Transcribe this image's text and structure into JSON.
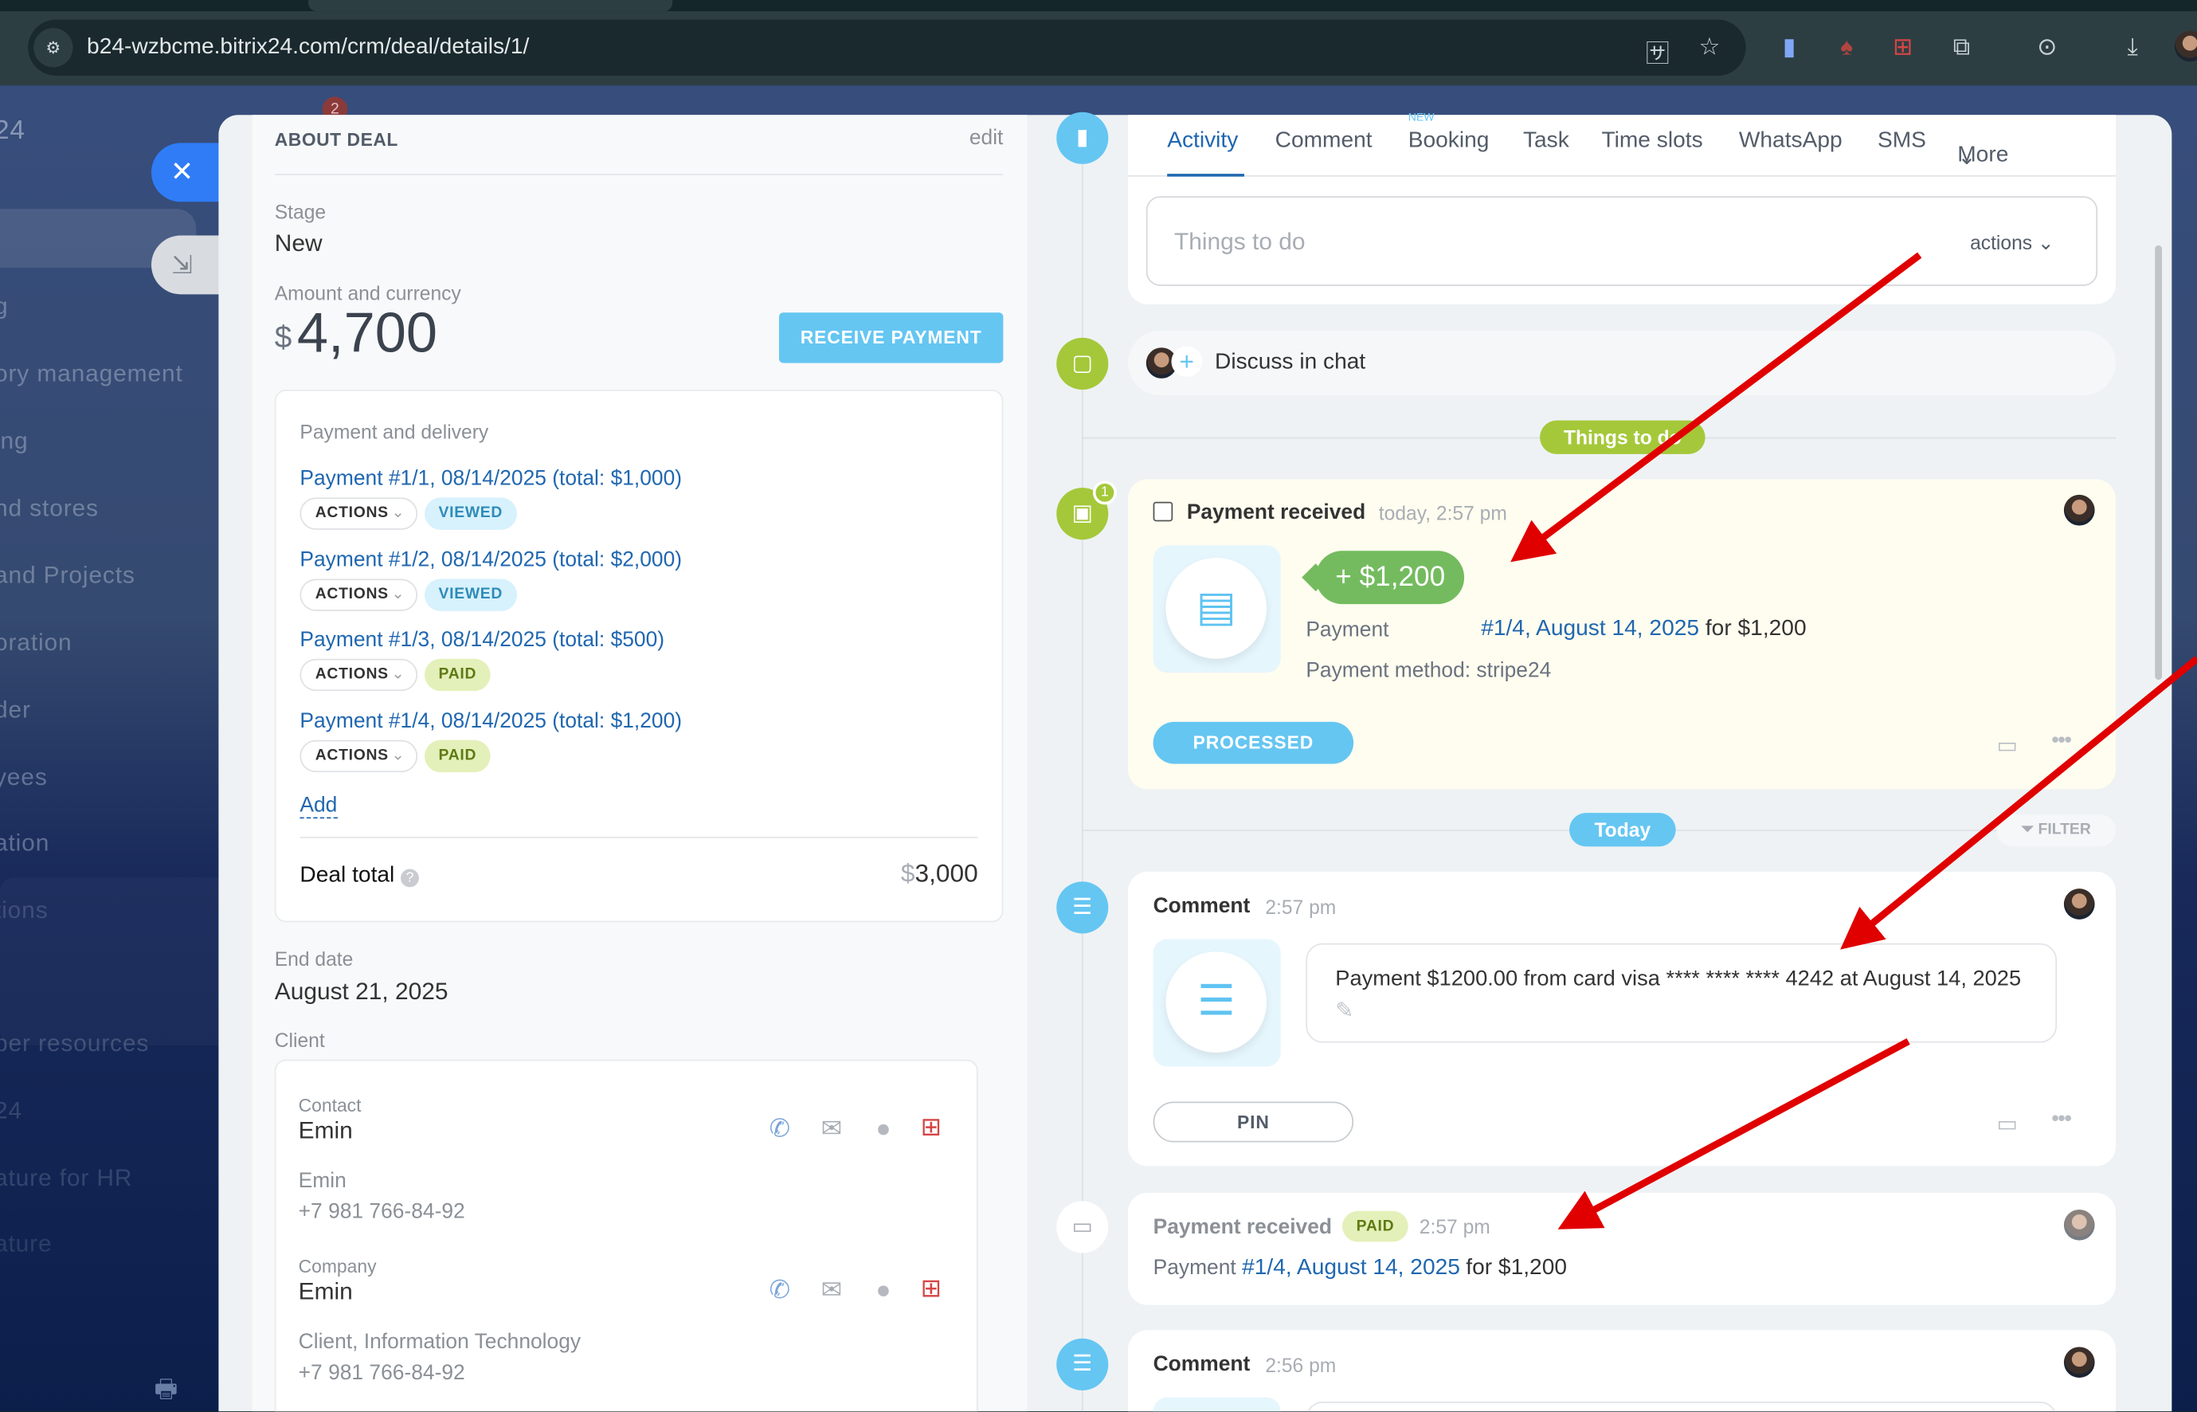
{
  "browser": {
    "url": "b24-wzbcme.bitrix24.com/crm/deal/details/1/",
    "icons": [
      "site-settings-icon",
      "translate-icon",
      "star-icon",
      "extension-blue-icon",
      "extension-red-icon",
      "extension-chat-icon",
      "puzzle-icon",
      "screenshot-icon",
      "download-icon",
      "profile-avatar"
    ]
  },
  "sidebar": {
    "logo": "24",
    "notification_count": "2",
    "items": [
      "g",
      "ory management",
      "ing",
      "nd stores",
      "and Projects",
      "oration",
      "der",
      "yees",
      "ation",
      "tions",
      "per resources",
      "24",
      "ature for HR",
      "ature"
    ]
  },
  "slider": {
    "close_icon": "✕",
    "minimize_icon": "⇲"
  },
  "about": {
    "heading": "ABOUT DEAL",
    "edit": "edit",
    "stage_label": "Stage",
    "stage_value": "New",
    "amount_label": "Amount and currency",
    "currency_symbol": "$",
    "amount": "4,700",
    "receive_payment": "RECEIVE PAYMENT",
    "payment_section": "Payment and delivery",
    "payments": [
      {
        "title": "Payment #1/1, 08/14/2025 (total: $1,000)",
        "actions": "ACTIONS",
        "status": "VIEWED"
      },
      {
        "title": "Payment #1/2, 08/14/2025 (total: $2,000)",
        "actions": "ACTIONS",
        "status": "VIEWED"
      },
      {
        "title": "Payment #1/3, 08/14/2025 (total: $500)",
        "actions": "ACTIONS",
        "status": "PAID"
      },
      {
        "title": "Payment #1/4, 08/14/2025 (total: $1,200)",
        "actions": "ACTIONS",
        "status": "PAID"
      }
    ],
    "add": "Add",
    "deal_total_label": "Deal total",
    "deal_total_currency": "$",
    "deal_total": "3,000",
    "end_date_label": "End date",
    "end_date": "August 21, 2025",
    "client_label": "Client",
    "contact_label": "Contact",
    "contact_name": "Emin",
    "contact_sub": "Emin",
    "contact_phone": "+7 981 766-84-92",
    "company_label": "Company",
    "company_name": "Emin",
    "company_sub": "Client, Information Technology",
    "company_phone": "+7 981 766-84-92"
  },
  "timeline": {
    "tabs": [
      "Activity",
      "Comment",
      "Booking",
      "Task",
      "Time slots",
      "WhatsApp",
      "SMS",
      "More"
    ],
    "new_badge": "NEW",
    "todo_placeholder": "Things to do",
    "actions": "actions",
    "discuss": "Discuss in chat",
    "things_to_do_divider": "Things to do",
    "payment_card": {
      "counter": "1",
      "title": "Payment received",
      "time": "today, 2:57 pm",
      "amount": "+ $1,200",
      "payment_label": "Payment",
      "payment_link": "#1/4, August 14, 2025",
      "payment_for": "for $1,200",
      "method": "Payment method: stripe24",
      "processed": "PROCESSED"
    },
    "today_divider": "Today",
    "filter": "FILTER",
    "comment1": {
      "title": "Comment",
      "time": "2:57 pm",
      "text": "Payment $1200.00 from card visa **** **** **** 4242 at August 14, 2025",
      "pin": "PIN"
    },
    "payment_history": {
      "title": "Payment received",
      "status": "PAID",
      "time": "2:57 pm",
      "prefix": "Payment",
      "link": "#1/4, August 14, 2025",
      "suffix": "for $1,200"
    },
    "comment2": {
      "title": "Comment",
      "time": "2:56 pm"
    }
  },
  "colors": {
    "accent": "#2f7cf6",
    "link": "#2067b0",
    "light_blue": "#65c6f2",
    "green": "#a5c83a",
    "annotation": "#e00000"
  }
}
